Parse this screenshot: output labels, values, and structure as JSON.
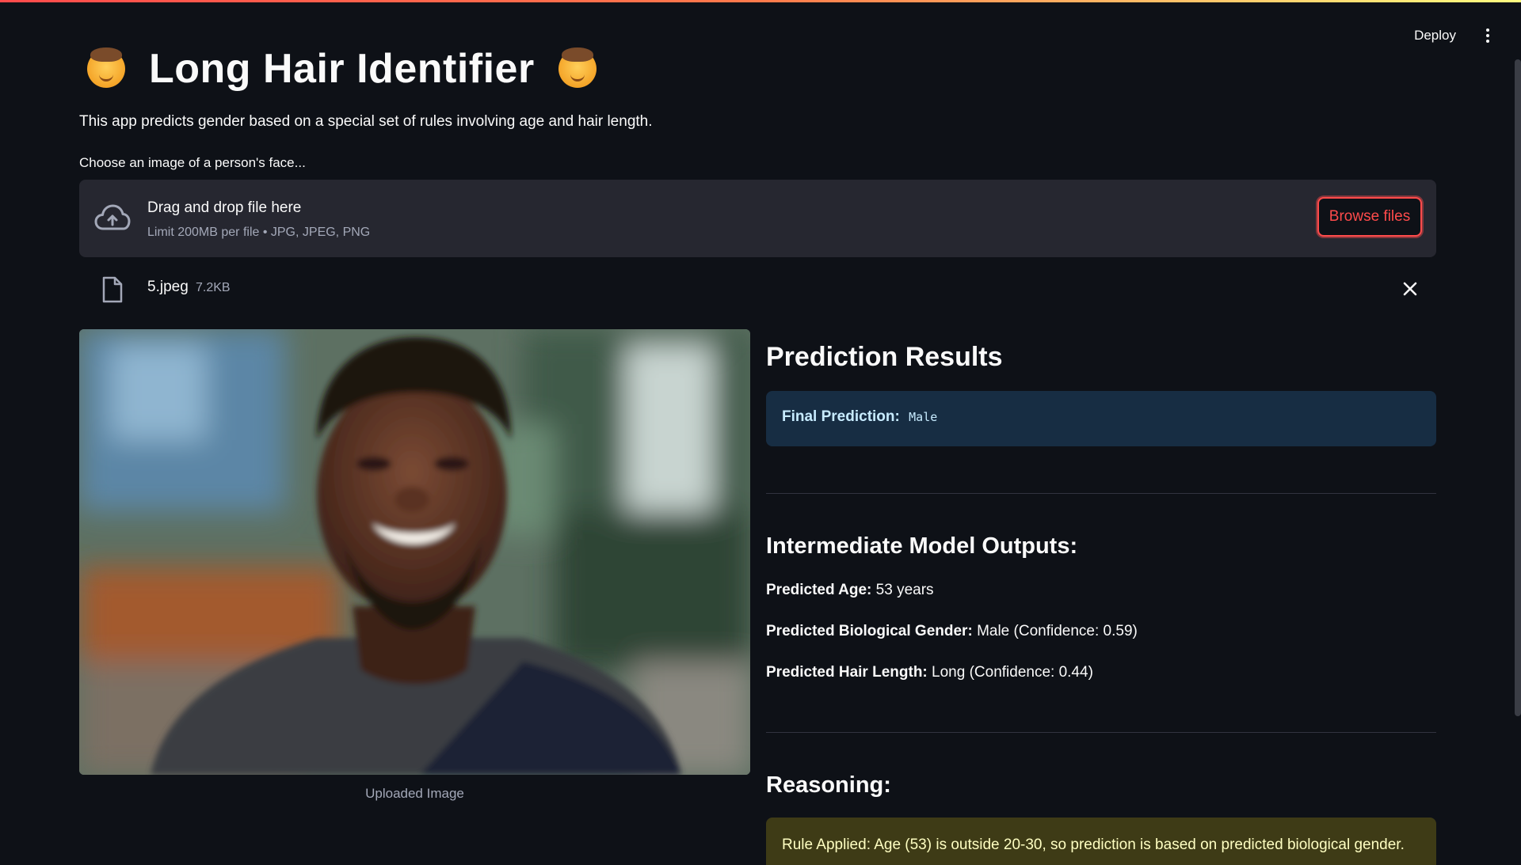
{
  "header": {
    "deploy_label": "Deploy"
  },
  "app": {
    "title": "Long Hair Identifier",
    "subtitle": "This app predicts gender based on a special set of rules involving age and hair length.",
    "uploader_label": "Choose an image of a person's face..."
  },
  "uploader": {
    "drop_title": "Drag and drop file here",
    "limit_text": "Limit 200MB per file • JPG, JPEG, PNG",
    "browse_label": "Browse files",
    "file": {
      "name": "5.jpeg",
      "size": "7.2KB"
    }
  },
  "image": {
    "caption": "Uploaded Image"
  },
  "results": {
    "heading": "Prediction Results",
    "final_label": "Final Prediction:",
    "final_value": "Male",
    "intermediate_heading": "Intermediate Model Outputs:",
    "age_label": "Predicted Age:",
    "age_value": "53 years",
    "gender_label": "Predicted Biological Gender:",
    "gender_value": "Male (Confidence: 0.59)",
    "hair_label": "Predicted Hair Length:",
    "hair_value": "Long (Confidence: 0.44)",
    "reasoning_heading": "Reasoning:",
    "rule_text": "Rule Applied: Age (53) is outside 20-30, so prediction is based on predicted biological gender."
  },
  "colors": {
    "background": "#0e1117",
    "accent": "#ff4b4b",
    "info_bg": "#172d43",
    "warning_bg": "#3e3b16"
  },
  "icons": {
    "title_left": "long-hair-person-emoji-icon",
    "title_right": "long-hair-person-emoji-icon",
    "upload": "cloud-upload-icon",
    "file": "file-icon",
    "remove": "close-icon",
    "menu": "vertical-dots-menu-icon"
  }
}
